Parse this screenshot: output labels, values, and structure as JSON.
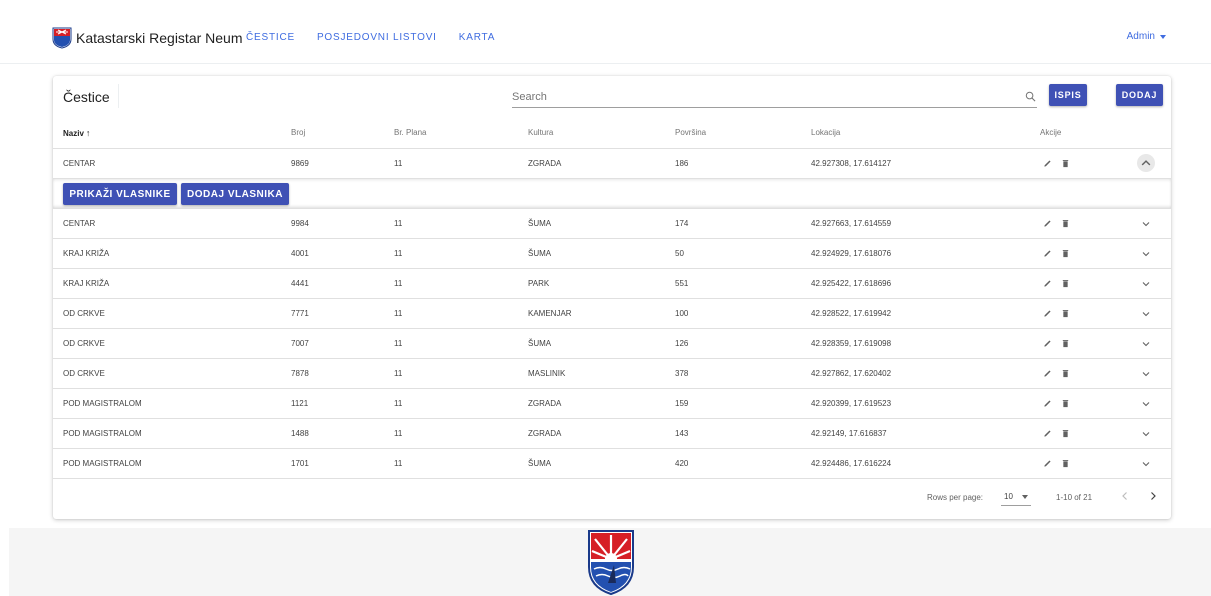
{
  "app": {
    "title": "Katastarski Registar Neum"
  },
  "nav": [
    {
      "label": "ČESTICE"
    },
    {
      "label": "POSJEDOVNI LISTOVI"
    },
    {
      "label": "KARTA"
    }
  ],
  "user": {
    "label": "Admin"
  },
  "card": {
    "title": "Čestice",
    "search_placeholder": "Search",
    "ispis_label": "ISPIS",
    "dodaj_label": "DODAJ"
  },
  "columns": {
    "naziv": "Naziv",
    "sort_arrow": "↑",
    "broj": "Broj",
    "plan": "Br. Plana",
    "kultura": "Kultura",
    "povrsina": "Površina",
    "lokacija": "Lokacija",
    "akcije": "Akcije"
  },
  "rows": [
    {
      "naziv": "CENTAR",
      "broj": "9869",
      "plan": "11",
      "kultura": "ZGRADA",
      "povrsina": "186",
      "lokacija": "42.927308, 17.614127",
      "expanded": true
    },
    {
      "naziv": "CENTAR",
      "broj": "9984",
      "plan": "11",
      "kultura": "ŠUMA",
      "povrsina": "174",
      "lokacija": "42.927663, 17.614559"
    },
    {
      "naziv": "KRAJ KRIŽA",
      "broj": "4001",
      "plan": "11",
      "kultura": "ŠUMA",
      "povrsina": "50",
      "lokacija": "42.924929, 17.618076"
    },
    {
      "naziv": "KRAJ KRIŽA",
      "broj": "4441",
      "plan": "11",
      "kultura": "PARK",
      "povrsina": "551",
      "lokacija": "42.925422, 17.618696"
    },
    {
      "naziv": "OD CRKVE",
      "broj": "7771",
      "plan": "11",
      "kultura": "KAMENJAR",
      "povrsina": "100",
      "lokacija": "42.928522, 17.619942"
    },
    {
      "naziv": "OD CRKVE",
      "broj": "7007",
      "plan": "11",
      "kultura": "ŠUMA",
      "povrsina": "126",
      "lokacija": "42.928359, 17.619098"
    },
    {
      "naziv": "OD CRKVE",
      "broj": "7878",
      "plan": "11",
      "kultura": "MASLINIK",
      "povrsina": "378",
      "lokacija": "42.927862, 17.620402"
    },
    {
      "naziv": "POD MAGISTRALOM",
      "broj": "1121",
      "plan": "11",
      "kultura": "ZGRADA",
      "povrsina": "159",
      "lokacija": "42.920399, 17.619523"
    },
    {
      "naziv": "POD MAGISTRALOM",
      "broj": "1488",
      "plan": "11",
      "kultura": "ZGRADA",
      "povrsina": "143",
      "lokacija": "42.92149, 17.616837"
    },
    {
      "naziv": "POD MAGISTRALOM",
      "broj": "1701",
      "plan": "11",
      "kultura": "ŠUMA",
      "povrsina": "420",
      "lokacija": "42.924486, 17.616224"
    }
  ],
  "detail": {
    "prikazi_label": "PRIKAŽI VLASNIKE",
    "dodaj_vlasnika_label": "DODAJ VLASNIKA"
  },
  "pagination": {
    "rows_per_page_label": "Rows per page:",
    "rows_per_page_value": "10",
    "range": "1-10 of 21"
  },
  "colors": {
    "accent": "#3f51b5",
    "link": "#3f6ce0"
  },
  "icons": [
    "neum-logo-icon",
    "search-icon",
    "edit-icon",
    "delete-icon",
    "chevron-down-icon",
    "chevron-up-icon",
    "chevron-left-icon",
    "chevron-right-icon"
  ]
}
